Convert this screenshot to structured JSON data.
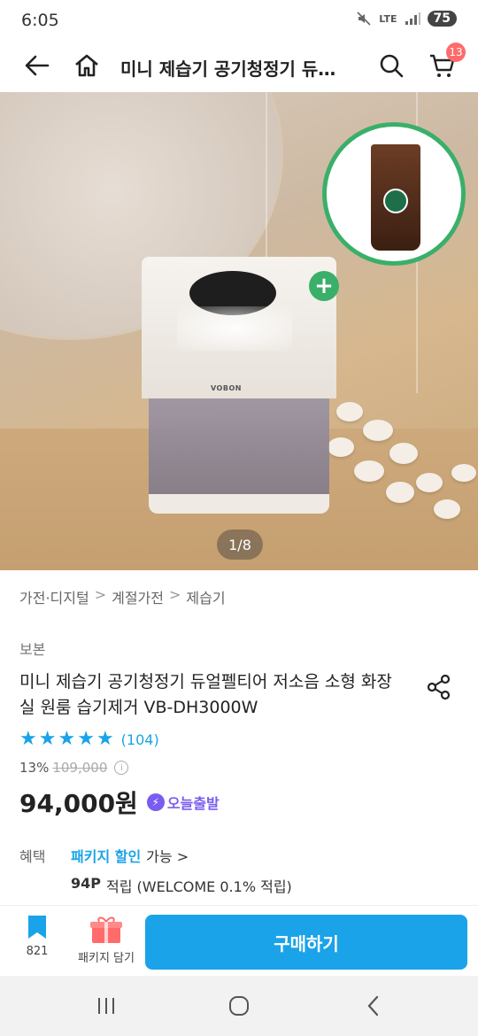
{
  "status_bar": {
    "time": "6:05",
    "network": "LTE",
    "battery": "75"
  },
  "header": {
    "title": "미니 제습기 공기청정기 듀…",
    "cart_count": "13"
  },
  "hero": {
    "page_indicator": "1/8",
    "device_brand": "VOBON"
  },
  "breadcrumb": [
    "가전·디지털",
    "계절가전",
    "제습기"
  ],
  "product": {
    "brand": "보본",
    "title": "미니 제습기 공기청정기 듀얼펠티어 저소음 소형 화장실 원룸 습기제거  VB-DH3000W",
    "rating_stars": 5,
    "review_count": "(104)",
    "discount_rate": "13%",
    "original_price": "109,000",
    "price": "94,000원",
    "delivery_badge": "오늘출발"
  },
  "benefits": {
    "label": "혜택",
    "package_link": "패키지 할인",
    "package_suffix": "가능 >",
    "points": "94P",
    "points_suffix": "적립 (WELCOME 0.1% 적립)"
  },
  "action_bar": {
    "bookmark_count": "821",
    "package_label": "패키지 담기",
    "buy_label": "구매하기"
  },
  "colors": {
    "accent": "#1aa3e8",
    "promo_green": "#3aaf6a",
    "delivery_purple": "#7a5cf0",
    "cart_badge": "#ff6b6b"
  }
}
